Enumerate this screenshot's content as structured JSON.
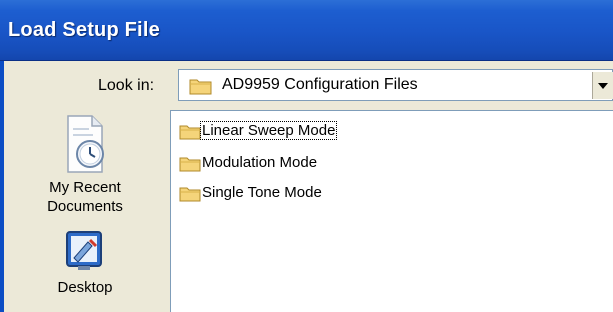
{
  "dialog": {
    "title": "Load Setup File"
  },
  "look_in": {
    "label": "Look in:",
    "value": "AD9959 Configuration Files"
  },
  "places": [
    {
      "label_lines": [
        "My Recent",
        "Documents"
      ],
      "icon": "recent-documents-icon"
    },
    {
      "label_lines": [
        "Desktop"
      ],
      "icon": "desktop-icon"
    }
  ],
  "files": [
    {
      "name": "Linear Sweep Mode",
      "icon": "folder-icon",
      "focused": true
    },
    {
      "name": "Modulation Mode",
      "icon": "folder-icon",
      "focused": false
    },
    {
      "name": "Single Tone Mode",
      "icon": "folder-icon",
      "focused": false
    }
  ],
  "colors": {
    "titlebar": "#1955c7",
    "dialog_bg": "#ece9d8",
    "folder": "#f5d47a"
  }
}
